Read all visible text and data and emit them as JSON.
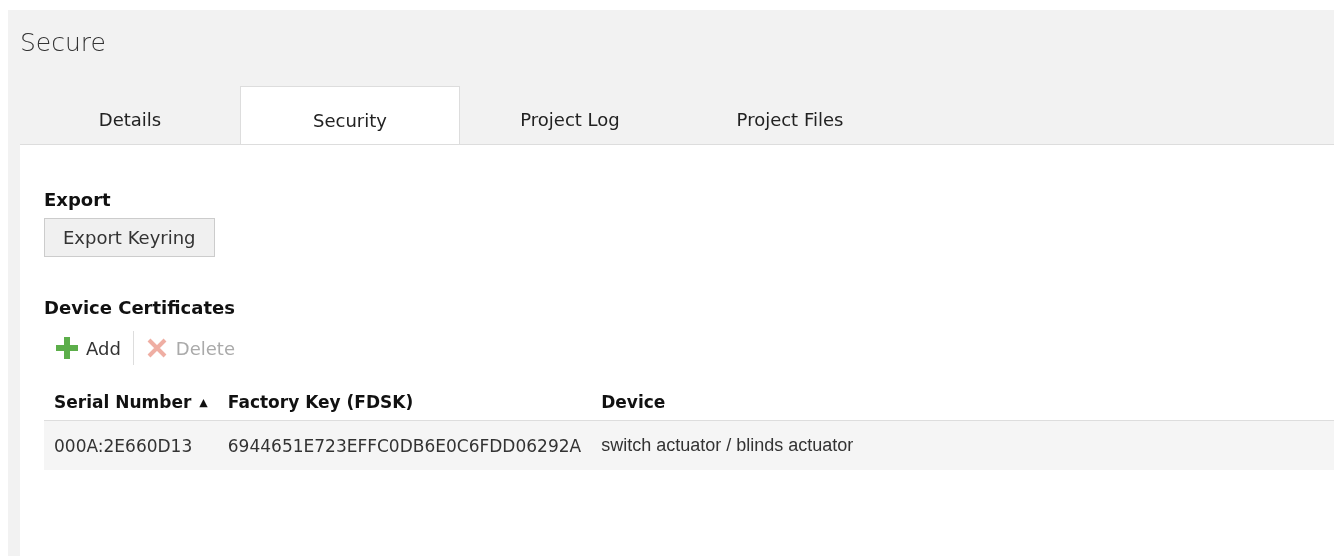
{
  "window": {
    "title": "Secure"
  },
  "tabs": [
    {
      "label": "Details",
      "selected": false
    },
    {
      "label": "Security",
      "selected": true
    },
    {
      "label": "Project Log",
      "selected": false
    },
    {
      "label": "Project Files",
      "selected": false
    }
  ],
  "export": {
    "heading": "Export",
    "button": "Export Keyring"
  },
  "certificates": {
    "heading": "Device Certificates",
    "toolbar": [
      {
        "kind": "add",
        "label": "Add",
        "disabled": false
      },
      {
        "kind": "delete",
        "label": "Delete",
        "disabled": true
      }
    ],
    "table": {
      "columns": [
        {
          "label": "Serial Number",
          "sort_indicator": "▲"
        },
        {
          "label": "Factory Key (FDSK)"
        },
        {
          "label": "Device"
        }
      ],
      "rows": [
        [
          "000A:2E660D13",
          "6944651E723EFFC0DB6E0C6FDD06292A",
          "switch actuator / blinds actuator"
        ]
      ]
    }
  }
}
